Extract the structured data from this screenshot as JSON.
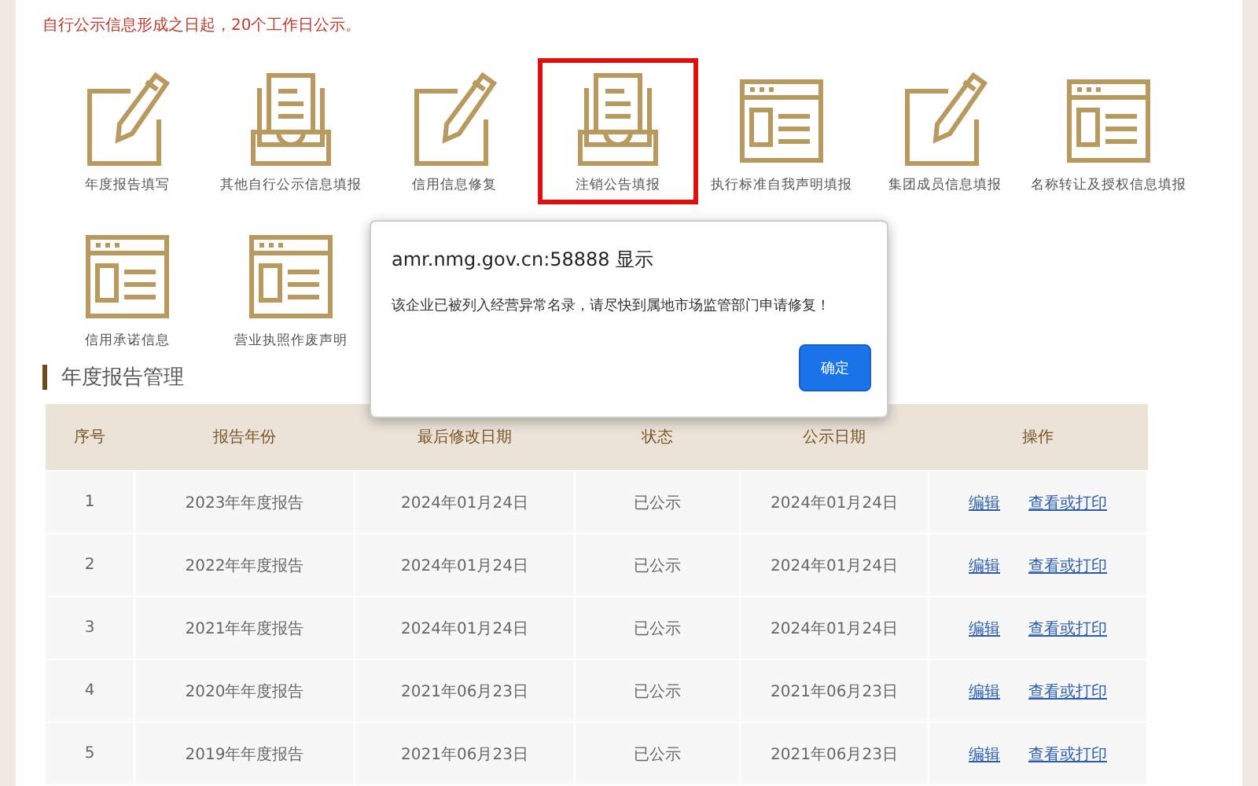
{
  "notice": "自行公示信息形成之日起，20个工作日公示。",
  "tiles": [
    {
      "label": "年度报告填写",
      "kind": "pencil",
      "highlighted": false
    },
    {
      "label": "其他自行公示信息填报",
      "kind": "tray",
      "highlighted": false
    },
    {
      "label": "信用信息修复",
      "kind": "pencil",
      "highlighted": false
    },
    {
      "label": "注销公告填报",
      "kind": "tray",
      "highlighted": true
    },
    {
      "label": "执行标准自我声明填报",
      "kind": "form",
      "highlighted": false
    },
    {
      "label": "集团成员信息填报",
      "kind": "pencil",
      "highlighted": false
    },
    {
      "label": "名称转让及授权信息填报",
      "kind": "form",
      "highlighted": false
    },
    {
      "label": "信用承诺信息",
      "kind": "form",
      "highlighted": false
    },
    {
      "label": "营业执照作废声明",
      "kind": "form",
      "highlighted": false
    }
  ],
  "section_title": "年度报告管理",
  "table": {
    "columns": [
      "序号",
      "报告年份",
      "最后修改日期",
      "状态",
      "公示日期",
      "操作"
    ],
    "rows": [
      {
        "cells": [
          "1",
          "2023年年度报告",
          "2024年01月24日",
          "已公示",
          "2024年01月24日"
        ],
        "actions": [
          "编辑",
          "查看或打印"
        ]
      },
      {
        "cells": [
          "2",
          "2022年年度报告",
          "2024年01月24日",
          "已公示",
          "2024年01月24日"
        ],
        "actions": [
          "编辑",
          "查看或打印"
        ]
      },
      {
        "cells": [
          "3",
          "2021年年度报告",
          "2024年01月24日",
          "已公示",
          "2024年01月24日"
        ],
        "actions": [
          "编辑",
          "查看或打印"
        ]
      },
      {
        "cells": [
          "4",
          "2020年年度报告",
          "2021年06月23日",
          "已公示",
          "2021年06月23日"
        ],
        "actions": [
          "编辑",
          "查看或打印"
        ]
      },
      {
        "cells": [
          "5",
          "2019年年度报告",
          "2021年06月23日",
          "已公示",
          "2021年06月23日"
        ],
        "actions": [
          "编辑",
          "查看或打印"
        ]
      }
    ]
  },
  "dialog": {
    "title": "amr.nmg.gov.cn:58888 显示",
    "message": "该企业已被列入经营异常名录，请尽快到属地市场监管部门申请修复！",
    "button": "确定"
  }
}
